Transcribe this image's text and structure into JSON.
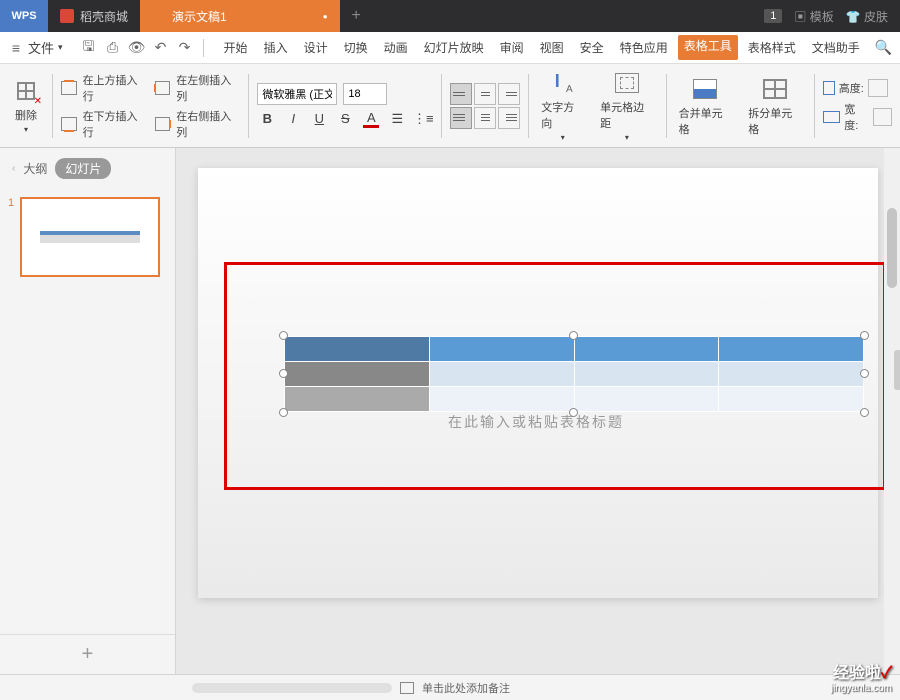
{
  "titlebar": {
    "app": "WPS",
    "tabs": [
      {
        "label": "稻壳商城",
        "icon": "red"
      },
      {
        "label": "演示文稿1",
        "icon": "orange"
      }
    ],
    "count": "1",
    "template": "模板",
    "skin": "皮肤"
  },
  "menubar": {
    "file": "文件",
    "tabs": [
      "开始",
      "插入",
      "设计",
      "切换",
      "动画",
      "幻灯片放映",
      "审阅",
      "视图",
      "安全",
      "特色应用"
    ],
    "highlight": "表格工具",
    "extras": [
      "表格样式",
      "文档助手"
    ]
  },
  "ribbon": {
    "delete": "删除",
    "insertRowAbove": "在上方插入行",
    "insertRowBelow": "在下方插入行",
    "insertColLeft": "在左侧插入列",
    "insertColRight": "在右侧插入列",
    "fontName": "微软雅黑 (正文)",
    "fontSize": "18",
    "bold": "B",
    "italic": "I",
    "underline": "U",
    "strike": "S",
    "fontColor": "A",
    "textDirection": "文字方向",
    "cellMargin": "单元格边距",
    "mergeCells": "合并单元格",
    "splitCell": "拆分单元格",
    "height": "高度:",
    "width": "宽度:"
  },
  "sidepanel": {
    "outline": "大纲",
    "slides": "幻灯片",
    "slideNum": "1"
  },
  "canvas": {
    "placeholderBehind": "在此输入或粘贴表格标题"
  },
  "statusbar": {
    "notes": "单击此处添加备注"
  },
  "watermark": {
    "line1": "经验啦",
    "line2": "jingyanla.com"
  }
}
